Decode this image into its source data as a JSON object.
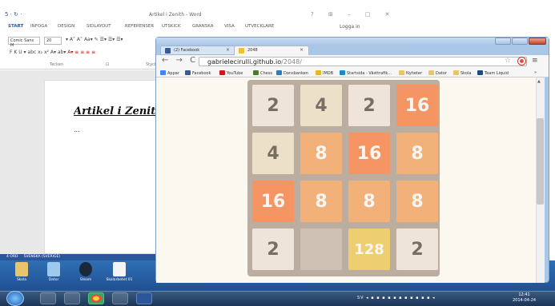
{
  "word": {
    "title": "Artikel i Zenith - Word",
    "quick_access": "5 · ↻ ·",
    "controls": "? ⊞ – □ ✕",
    "tabs": [
      "START",
      "INFOGA",
      "DESIGN",
      "SIDLAYOUT",
      "REFERENSER",
      "UTSKICK",
      "GRANSKA",
      "VISA",
      "UTVECKLARE"
    ],
    "login": "Logga in",
    "font_name": "Comic Sans M",
    "font_size": "20",
    "fmt_row1": "▾ A˄ A˅  Aa▾  ✎  ☰▾ ☰▾ ☰▾",
    "fmt_row2_a": "F  K  U ▾ abc  x₂  x²   A▾  ab▾",
    "fmt_row2_b": "A▾   ≡  ≡  ≡  ≡",
    "group_font": "Tecken",
    "group_para": "⊡",
    "group_style": "Styck",
    "doc_heading": "Artikel i Zenith",
    "doc_dots": "...",
    "status_words": "4 ORD",
    "status_lang": "SVENSKA (SVERIGE)"
  },
  "desktop_icons": [
    {
      "label": "Skola"
    },
    {
      "label": "Dator"
    },
    {
      "label": "Steam"
    },
    {
      "label": "Skolarbetet 01"
    }
  ],
  "taskbar": {
    "tray": "SV ◂ ▪ ▪ ▪ ▪ ▪ ▪ ▪ ▪ ▪ ▪ ▪ ◂",
    "time": "12:41",
    "date": "2014-04-24"
  },
  "chrome": {
    "tabs": [
      {
        "label": "(2) Facebook",
        "close": "×"
      },
      {
        "label": "2048",
        "close": "×"
      }
    ],
    "nav": "← → C",
    "url_host": "gabrielecirulli.github.io",
    "url_path": "/2048/",
    "star": "☆",
    "menu": "≡",
    "bookmarks": [
      {
        "label": "Appar",
        "color": "#4285f4"
      },
      {
        "label": "Facebook",
        "color": "#3b5998"
      },
      {
        "label": "YouTube",
        "color": "#cc181e"
      },
      {
        "label": "Chess",
        "color": "#4a7a2c"
      },
      {
        "label": "Dansbanken",
        "color": "#2f7bbf"
      },
      {
        "label": "IMDB",
        "color": "#e6b91e"
      },
      {
        "label": "Startsida - Västtrafik...",
        "color": "#1f89c7"
      },
      {
        "label": "Nyheter",
        "color": "#e8c56a"
      },
      {
        "label": "Dator",
        "color": "#e8c56a"
      },
      {
        "label": "Skola",
        "color": "#e8c56a"
      },
      {
        "label": "Team Liquid",
        "color": "#1b4b7a"
      }
    ],
    "bookmarks_more": "»"
  },
  "game": {
    "grid": [
      [
        "2",
        "4",
        "2",
        "16"
      ],
      [
        "4",
        "8",
        "16",
        "8"
      ],
      [
        "16",
        "8",
        "8",
        "8"
      ],
      [
        "2",
        "",
        "128",
        "2"
      ]
    ],
    "colors": {
      "2": "#eee4da",
      "4": "#ede0c8",
      "8": "#f2b179",
      "16": "#f59563",
      "128": "#edcf72",
      "empty": "#cdc1b4",
      "dark_text": "#776e65",
      "light_text": "#f9f6f2"
    }
  }
}
